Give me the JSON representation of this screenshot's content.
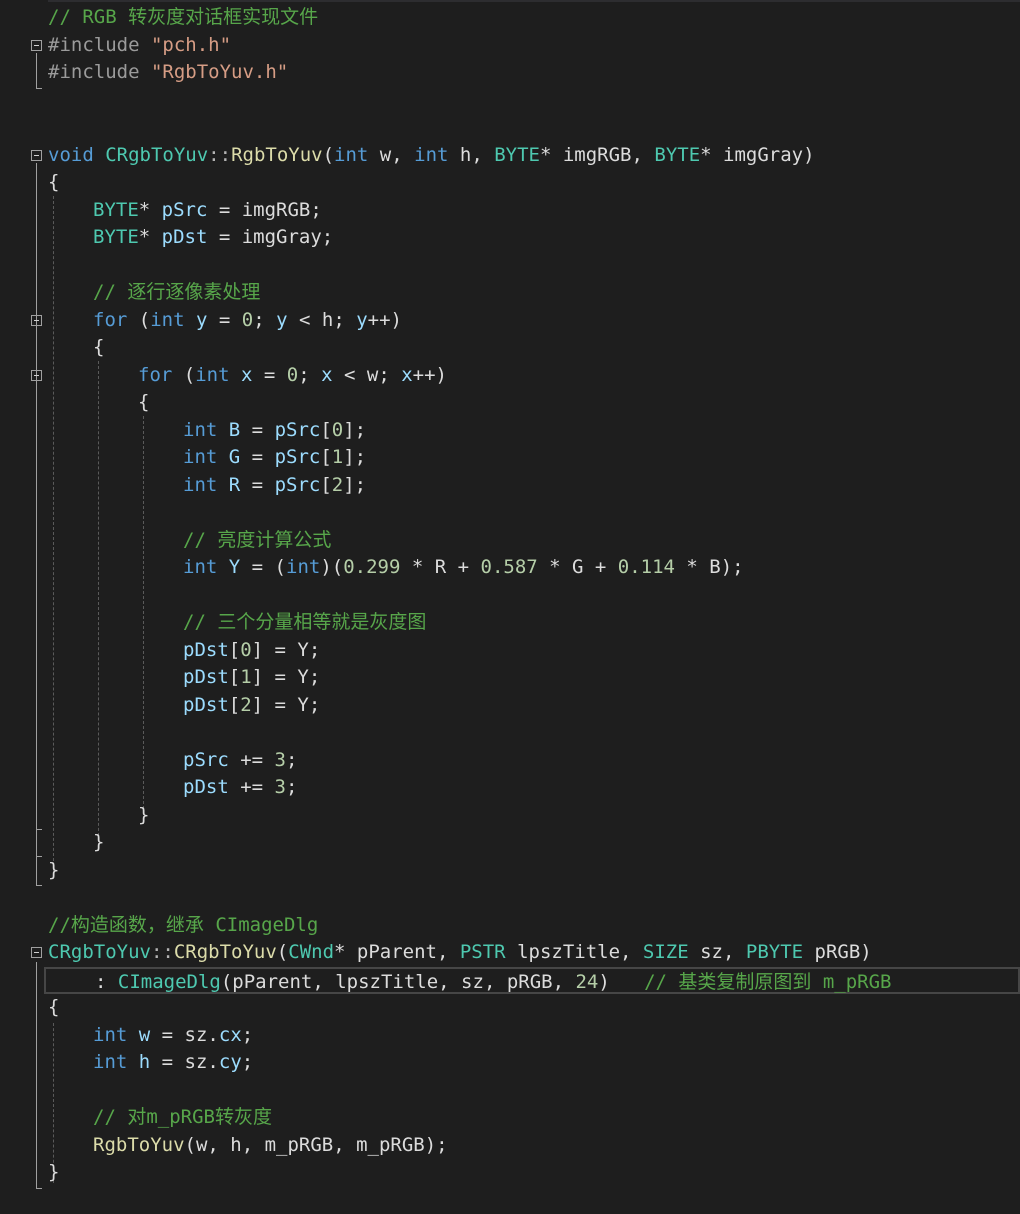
{
  "editor": {
    "language": "C++",
    "theme_colors": {
      "background": "#1e1e1e",
      "comment": "#57a64a",
      "keyword": "#569cd6",
      "preprocessor": "#9b9b9b",
      "string": "#d69d85",
      "type": "#4ec9b0",
      "function": "#dcdcaa",
      "variable": "#9cdcfe",
      "number": "#b5cea8",
      "operator": "#b4b4b4",
      "current_line_border": "#464646"
    }
  },
  "lines": [
    {
      "id": "line-01",
      "indent": 0,
      "tokens": [
        {
          "t": "// RGB 转灰度对话框实现文件",
          "c": "cm"
        }
      ]
    },
    {
      "id": "line-02",
      "indent": 0,
      "fold": "collapse-icon",
      "tokens": [
        {
          "t": "#include ",
          "c": "pp"
        },
        {
          "t": "\"pch.h\"",
          "c": "st"
        }
      ]
    },
    {
      "id": "line-03",
      "indent": 0,
      "tokens": [
        {
          "t": "#include ",
          "c": "pp"
        },
        {
          "t": "\"RgbToYuv.h\"",
          "c": "st"
        }
      ]
    },
    {
      "id": "line-04",
      "indent": 0,
      "tokens": []
    },
    {
      "id": "line-05",
      "indent": 0,
      "tokens": []
    },
    {
      "id": "line-06",
      "indent": 0,
      "fold": "collapse-icon",
      "tokens": [
        {
          "t": "void",
          "c": "kw"
        },
        {
          "t": " ",
          "c": "tx"
        },
        {
          "t": "CRgbToYuv",
          "c": "ty"
        },
        {
          "t": "::",
          "c": "op"
        },
        {
          "t": "RgbToYuv",
          "c": "fn"
        },
        {
          "t": "(",
          "c": "pn"
        },
        {
          "t": "int",
          "c": "kw"
        },
        {
          "t": " w, ",
          "c": "tx"
        },
        {
          "t": "int",
          "c": "kw"
        },
        {
          "t": " h, ",
          "c": "tx"
        },
        {
          "t": "BYTE",
          "c": "ty"
        },
        {
          "t": "* imgRGB, ",
          "c": "tx"
        },
        {
          "t": "BYTE",
          "c": "ty"
        },
        {
          "t": "* imgGray)",
          "c": "tx"
        }
      ]
    },
    {
      "id": "line-07",
      "indent": 0,
      "tokens": [
        {
          "t": "{",
          "c": "pn"
        }
      ]
    },
    {
      "id": "line-08",
      "indent": 1,
      "tokens": [
        {
          "t": "BYTE",
          "c": "ty"
        },
        {
          "t": "* ",
          "c": "tx"
        },
        {
          "t": "pSrc",
          "c": "vr"
        },
        {
          "t": " = imgRGB;",
          "c": "tx"
        }
      ]
    },
    {
      "id": "line-09",
      "indent": 1,
      "tokens": [
        {
          "t": "BYTE",
          "c": "ty"
        },
        {
          "t": "* ",
          "c": "tx"
        },
        {
          "t": "pDst",
          "c": "vr"
        },
        {
          "t": " = imgGray;",
          "c": "tx"
        }
      ]
    },
    {
      "id": "line-10",
      "indent": 1,
      "tokens": []
    },
    {
      "id": "line-11",
      "indent": 1,
      "tokens": [
        {
          "t": "// 逐行逐像素处理",
          "c": "cm"
        }
      ]
    },
    {
      "id": "line-12",
      "indent": 1,
      "fold": "collapse-icon",
      "tokens": [
        {
          "t": "for",
          "c": "kw"
        },
        {
          "t": " (",
          "c": "tx"
        },
        {
          "t": "int",
          "c": "kw"
        },
        {
          "t": " ",
          "c": "tx"
        },
        {
          "t": "y",
          "c": "vr"
        },
        {
          "t": " = ",
          "c": "tx"
        },
        {
          "t": "0",
          "c": "nm"
        },
        {
          "t": "; ",
          "c": "tx"
        },
        {
          "t": "y",
          "c": "vr"
        },
        {
          "t": " < h; ",
          "c": "tx"
        },
        {
          "t": "y",
          "c": "vr"
        },
        {
          "t": "++)",
          "c": "tx"
        }
      ]
    },
    {
      "id": "line-13",
      "indent": 1,
      "tokens": [
        {
          "t": "{",
          "c": "pn"
        }
      ]
    },
    {
      "id": "line-14",
      "indent": 2,
      "fold": "collapse-icon",
      "tokens": [
        {
          "t": "for",
          "c": "kw"
        },
        {
          "t": " (",
          "c": "tx"
        },
        {
          "t": "int",
          "c": "kw"
        },
        {
          "t": " ",
          "c": "tx"
        },
        {
          "t": "x",
          "c": "vr"
        },
        {
          "t": " = ",
          "c": "tx"
        },
        {
          "t": "0",
          "c": "nm"
        },
        {
          "t": "; ",
          "c": "tx"
        },
        {
          "t": "x",
          "c": "vr"
        },
        {
          "t": " < w; ",
          "c": "tx"
        },
        {
          "t": "x",
          "c": "vr"
        },
        {
          "t": "++)",
          "c": "tx"
        }
      ]
    },
    {
      "id": "line-15",
      "indent": 2,
      "tokens": [
        {
          "t": "{",
          "c": "pn"
        }
      ]
    },
    {
      "id": "line-16",
      "indent": 3,
      "tokens": [
        {
          "t": "int",
          "c": "kw"
        },
        {
          "t": " ",
          "c": "tx"
        },
        {
          "t": "B",
          "c": "vr"
        },
        {
          "t": " = ",
          "c": "tx"
        },
        {
          "t": "pSrc",
          "c": "vr"
        },
        {
          "t": "[",
          "c": "tx"
        },
        {
          "t": "0",
          "c": "nm"
        },
        {
          "t": "];",
          "c": "tx"
        }
      ]
    },
    {
      "id": "line-17",
      "indent": 3,
      "tokens": [
        {
          "t": "int",
          "c": "kw"
        },
        {
          "t": " ",
          "c": "tx"
        },
        {
          "t": "G",
          "c": "vr"
        },
        {
          "t": " = ",
          "c": "tx"
        },
        {
          "t": "pSrc",
          "c": "vr"
        },
        {
          "t": "[",
          "c": "tx"
        },
        {
          "t": "1",
          "c": "nm"
        },
        {
          "t": "];",
          "c": "tx"
        }
      ]
    },
    {
      "id": "line-18",
      "indent": 3,
      "tokens": [
        {
          "t": "int",
          "c": "kw"
        },
        {
          "t": " ",
          "c": "tx"
        },
        {
          "t": "R",
          "c": "vr"
        },
        {
          "t": " = ",
          "c": "tx"
        },
        {
          "t": "pSrc",
          "c": "vr"
        },
        {
          "t": "[",
          "c": "tx"
        },
        {
          "t": "2",
          "c": "nm"
        },
        {
          "t": "];",
          "c": "tx"
        }
      ]
    },
    {
      "id": "line-19",
      "indent": 3,
      "tokens": []
    },
    {
      "id": "line-20",
      "indent": 3,
      "tokens": [
        {
          "t": "// 亮度计算公式",
          "c": "cm"
        }
      ]
    },
    {
      "id": "line-21",
      "indent": 3,
      "tokens": [
        {
          "t": "int",
          "c": "kw"
        },
        {
          "t": " ",
          "c": "tx"
        },
        {
          "t": "Y",
          "c": "vr"
        },
        {
          "t": " = (",
          "c": "tx"
        },
        {
          "t": "int",
          "c": "kw"
        },
        {
          "t": ")(",
          "c": "tx"
        },
        {
          "t": "0.299",
          "c": "nm"
        },
        {
          "t": " * R + ",
          "c": "tx"
        },
        {
          "t": "0.587",
          "c": "nm"
        },
        {
          "t": " * G + ",
          "c": "tx"
        },
        {
          "t": "0.114",
          "c": "nm"
        },
        {
          "t": " * B);",
          "c": "tx"
        }
      ]
    },
    {
      "id": "line-22",
      "indent": 3,
      "tokens": []
    },
    {
      "id": "line-23",
      "indent": 3,
      "tokens": [
        {
          "t": "// 三个分量相等就是灰度图",
          "c": "cm"
        }
      ]
    },
    {
      "id": "line-24",
      "indent": 3,
      "tokens": [
        {
          "t": "pDst",
          "c": "vr"
        },
        {
          "t": "[",
          "c": "tx"
        },
        {
          "t": "0",
          "c": "nm"
        },
        {
          "t": "] = Y;",
          "c": "tx"
        }
      ]
    },
    {
      "id": "line-25",
      "indent": 3,
      "tokens": [
        {
          "t": "pDst",
          "c": "vr"
        },
        {
          "t": "[",
          "c": "tx"
        },
        {
          "t": "1",
          "c": "nm"
        },
        {
          "t": "] = Y;",
          "c": "tx"
        }
      ]
    },
    {
      "id": "line-26",
      "indent": 3,
      "tokens": [
        {
          "t": "pDst",
          "c": "vr"
        },
        {
          "t": "[",
          "c": "tx"
        },
        {
          "t": "2",
          "c": "nm"
        },
        {
          "t": "] = Y;",
          "c": "tx"
        }
      ]
    },
    {
      "id": "line-27",
      "indent": 3,
      "tokens": []
    },
    {
      "id": "line-28",
      "indent": 3,
      "tokens": [
        {
          "t": "pSrc",
          "c": "vr"
        },
        {
          "t": " += ",
          "c": "tx"
        },
        {
          "t": "3",
          "c": "nm"
        },
        {
          "t": ";",
          "c": "tx"
        }
      ]
    },
    {
      "id": "line-29",
      "indent": 3,
      "tokens": [
        {
          "t": "pDst",
          "c": "vr"
        },
        {
          "t": " += ",
          "c": "tx"
        },
        {
          "t": "3",
          "c": "nm"
        },
        {
          "t": ";",
          "c": "tx"
        }
      ]
    },
    {
      "id": "line-30",
      "indent": 2,
      "tokens": [
        {
          "t": "}",
          "c": "pn"
        }
      ]
    },
    {
      "id": "line-31",
      "indent": 1,
      "tokens": [
        {
          "t": "}",
          "c": "pn"
        }
      ]
    },
    {
      "id": "line-32",
      "indent": 0,
      "tokens": [
        {
          "t": "}",
          "c": "pn"
        }
      ]
    },
    {
      "id": "line-33",
      "indent": 0,
      "tokens": []
    },
    {
      "id": "line-34",
      "indent": 0,
      "tokens": [
        {
          "t": "//构造函数，继承 CImageDlg",
          "c": "cm"
        }
      ]
    },
    {
      "id": "line-35",
      "indent": 0,
      "fold": "collapse-icon",
      "tokens": [
        {
          "t": "CRgbToYuv",
          "c": "ty"
        },
        {
          "t": "::",
          "c": "op"
        },
        {
          "t": "CRgbToYuv",
          "c": "fn"
        },
        {
          "t": "(",
          "c": "pn"
        },
        {
          "t": "CWnd",
          "c": "ty"
        },
        {
          "t": "* pParent, ",
          "c": "tx"
        },
        {
          "t": "PSTR",
          "c": "ty"
        },
        {
          "t": " lpszTitle, ",
          "c": "tx"
        },
        {
          "t": "SIZE",
          "c": "ty"
        },
        {
          "t": " sz, ",
          "c": "tx"
        },
        {
          "t": "PBYTE",
          "c": "ty"
        },
        {
          "t": " pRGB)",
          "c": "tx"
        }
      ]
    },
    {
      "id": "line-36",
      "indent": 1,
      "current": true,
      "tokens": [
        {
          "t": ": ",
          "c": "tx"
        },
        {
          "t": "CImageDlg",
          "c": "ty"
        },
        {
          "t": "(pParent, lpszTitle, sz, pRGB, ",
          "c": "tx"
        },
        {
          "t": "24",
          "c": "nm"
        },
        {
          "t": ")   ",
          "c": "tx"
        },
        {
          "t": "// 基类复制原图到 m_pRGB",
          "c": "cm"
        }
      ]
    },
    {
      "id": "line-37",
      "indent": 0,
      "tokens": [
        {
          "t": "{",
          "c": "pn"
        }
      ]
    },
    {
      "id": "line-38",
      "indent": 1,
      "tokens": [
        {
          "t": "int",
          "c": "kw"
        },
        {
          "t": " ",
          "c": "tx"
        },
        {
          "t": "w",
          "c": "vr"
        },
        {
          "t": " = sz.",
          "c": "tx"
        },
        {
          "t": "cx",
          "c": "vr"
        },
        {
          "t": ";",
          "c": "tx"
        }
      ]
    },
    {
      "id": "line-39",
      "indent": 1,
      "tokens": [
        {
          "t": "int",
          "c": "kw"
        },
        {
          "t": " ",
          "c": "tx"
        },
        {
          "t": "h",
          "c": "vr"
        },
        {
          "t": " = sz.",
          "c": "tx"
        },
        {
          "t": "cy",
          "c": "vr"
        },
        {
          "t": ";",
          "c": "tx"
        }
      ]
    },
    {
      "id": "line-40",
      "indent": 1,
      "tokens": []
    },
    {
      "id": "line-41",
      "indent": 1,
      "tokens": [
        {
          "t": "// 对m_pRGB转灰度",
          "c": "cm"
        }
      ]
    },
    {
      "id": "line-42",
      "indent": 1,
      "tokens": [
        {
          "t": "RgbToYuv",
          "c": "fn"
        },
        {
          "t": "(w, h, m_pRGB, m_pRGB);",
          "c": "tx"
        }
      ]
    },
    {
      "id": "line-43",
      "indent": 0,
      "tokens": [
        {
          "t": "}",
          "c": "pn"
        }
      ]
    }
  ]
}
